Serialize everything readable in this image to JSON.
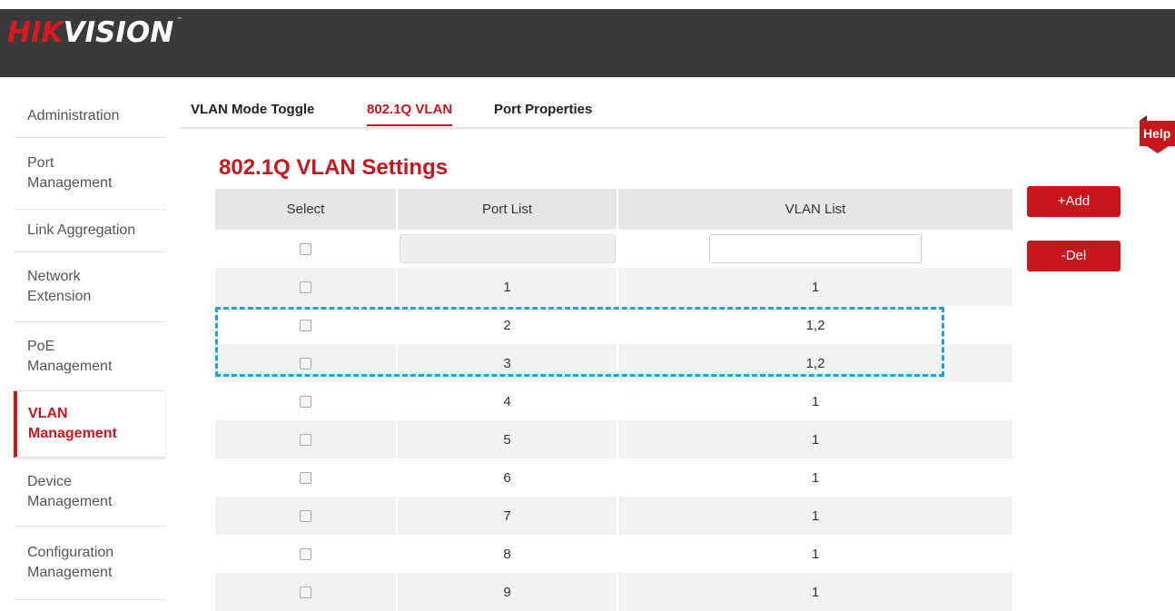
{
  "brand": {
    "logo_red": "HIK",
    "logo_white": "VISION",
    "tm": "™"
  },
  "sidebar": {
    "items": [
      {
        "label": "Administration",
        "active": false
      },
      {
        "label": "Port\nManagement",
        "active": false
      },
      {
        "label": "Link Aggregation",
        "active": false
      },
      {
        "label": "Network\nExtension",
        "active": false
      },
      {
        "label": "PoE\nManagement",
        "active": false
      },
      {
        "label": "VLAN\nManagement",
        "active": true
      },
      {
        "label": "Device\nManagement",
        "active": false
      },
      {
        "label": "Configuration\nManagement",
        "active": false
      }
    ]
  },
  "tabs": [
    {
      "label": "VLAN Mode Toggle",
      "active": false
    },
    {
      "label": "802.1Q VLAN",
      "active": true
    },
    {
      "label": "Port Properties",
      "active": false
    }
  ],
  "help_label": "Help",
  "page_title": "802.1Q VLAN Settings",
  "table": {
    "headers": {
      "select": "Select",
      "port_list": "Port List",
      "vlan_list": "VLAN List"
    },
    "rows": [
      {
        "port": "1",
        "vlan": "1"
      },
      {
        "port": "2",
        "vlan": "1,2"
      },
      {
        "port": "3",
        "vlan": "1,2"
      },
      {
        "port": "4",
        "vlan": "1"
      },
      {
        "port": "5",
        "vlan": "1"
      },
      {
        "port": "6",
        "vlan": "1"
      },
      {
        "port": "7",
        "vlan": "1"
      },
      {
        "port": "8",
        "vlan": "1"
      },
      {
        "port": "9",
        "vlan": "1"
      }
    ]
  },
  "buttons": {
    "add": "+Add",
    "del": "-Del"
  },
  "colors": {
    "accent": "#c8161d",
    "header_bar": "#3a3a3a",
    "highlight": "#1aa3e0"
  }
}
